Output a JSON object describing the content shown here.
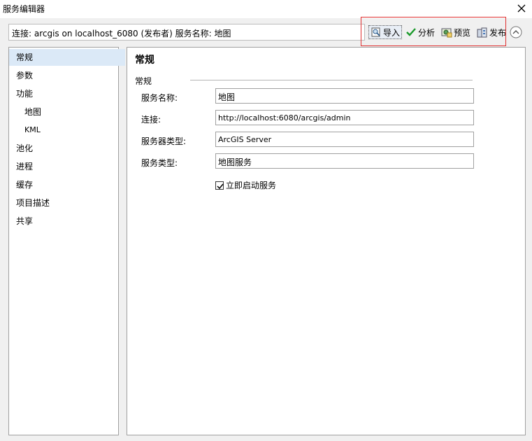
{
  "window": {
    "title": "服务编辑器"
  },
  "connection": {
    "text": "连接: arcgis on localhost_6080 (发布者)    服务名称: 地图"
  },
  "toolbar": {
    "import_label": "导入",
    "analyze_label": "分析",
    "preview_label": "预览",
    "publish_label": "发布"
  },
  "sidebar": {
    "items": [
      {
        "label": "常规"
      },
      {
        "label": "参数"
      },
      {
        "label": "功能"
      },
      {
        "label": "地图"
      },
      {
        "label": "KML"
      },
      {
        "label": "池化"
      },
      {
        "label": "进程"
      },
      {
        "label": "缓存"
      },
      {
        "label": "项目描述"
      },
      {
        "label": "共享"
      }
    ]
  },
  "main": {
    "heading": "常规",
    "group": "常规",
    "fields": [
      {
        "label": "服务名称:",
        "value": "地图"
      },
      {
        "label": "连接:",
        "value": "http://localhost:6080/arcgis/admin"
      },
      {
        "label": "服务器类型:",
        "value": "ArcGIS Server"
      },
      {
        "label": "服务类型:",
        "value": "地图服务"
      }
    ],
    "checkbox": {
      "label": "立即启动服务",
      "checked": true
    }
  },
  "colors": {
    "highlight_border": "#e03030",
    "selected_nav": "#dbe9f7",
    "check_green": "#1a9a2a"
  }
}
